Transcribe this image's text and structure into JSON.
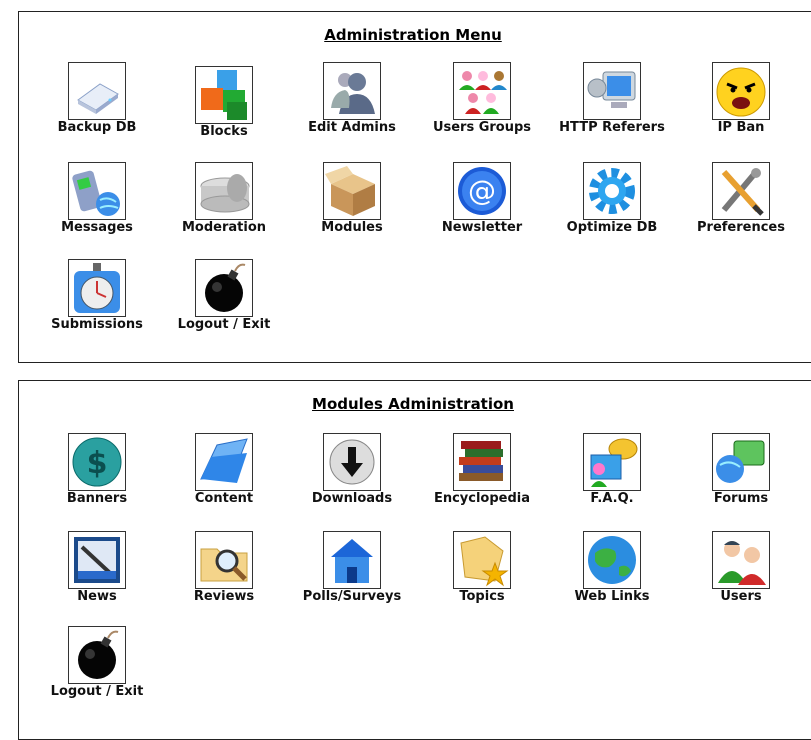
{
  "admin_menu": {
    "title": "Administration Menu",
    "items": [
      {
        "label": "Backup DB",
        "icon": "drive-icon"
      },
      {
        "label": "Blocks",
        "icon": "blocks-icon"
      },
      {
        "label": "Edit Admins",
        "icon": "admins-icon"
      },
      {
        "label": "Users Groups",
        "icon": "users-groups-icon"
      },
      {
        "label": "HTTP Referers",
        "icon": "monitor-icon"
      },
      {
        "label": "IP Ban",
        "icon": "angry-face-icon"
      },
      {
        "label": "Messages",
        "icon": "phone-globe-icon"
      },
      {
        "label": "Moderation",
        "icon": "cream-tin-icon"
      },
      {
        "label": "Modules",
        "icon": "box-icon"
      },
      {
        "label": "Newsletter",
        "icon": "at-sign-icon"
      },
      {
        "label": "Optimize DB",
        "icon": "gear-icon"
      },
      {
        "label": "Preferences",
        "icon": "tools-icon"
      },
      {
        "label": "Submissions",
        "icon": "stopwatch-icon"
      },
      {
        "label": "Logout / Exit",
        "icon": "bomb-icon"
      }
    ]
  },
  "modules_admin": {
    "title": "Modules Administration",
    "items": [
      {
        "label": "Banners",
        "icon": "dollar-icon"
      },
      {
        "label": "Content",
        "icon": "folder-icon"
      },
      {
        "label": "Downloads",
        "icon": "download-icon"
      },
      {
        "label": "Encyclopedia",
        "icon": "books-icon"
      },
      {
        "label": "F.A.Q.",
        "icon": "faq-icon"
      },
      {
        "label": "Forums",
        "icon": "forums-icon"
      },
      {
        "label": "News",
        "icon": "news-icon"
      },
      {
        "label": "Reviews",
        "icon": "magnifier-folder-icon"
      },
      {
        "label": "Polls/Surveys",
        "icon": "house-icon"
      },
      {
        "label": "Topics",
        "icon": "topics-star-icon"
      },
      {
        "label": "Web Links",
        "icon": "globe-icon"
      },
      {
        "label": "Users",
        "icon": "users-icon"
      },
      {
        "label": "Logout / Exit",
        "icon": "bomb-icon"
      }
    ]
  }
}
